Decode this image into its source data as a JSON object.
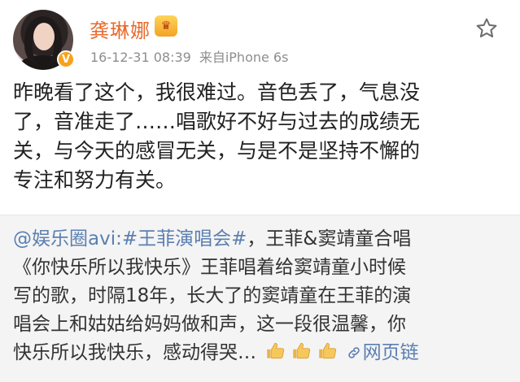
{
  "post": {
    "username": "龚琳娜",
    "vip_badge": "♛",
    "verified_badge": "V",
    "timestamp": "16-12-31 08:39",
    "source": "来自iPhone 6s",
    "content_lines": [
      "昨晚看了这个，我很难过。音色丢了，气息没",
      "了，音准走了……唱歌好不好与过去的成绩无",
      "关，与今天的感冒无关，与是不是坚持不懈的",
      "专注和努力有关。"
    ]
  },
  "repost": {
    "mention": "@娱乐圈avi:",
    "topic": "#王菲演唱会#",
    "line1_rest": "，王菲&窦靖童合唱",
    "line2": "《你快乐所以我快乐》王菲唱着给窦靖童小时候",
    "line3": "写的歌，时隔18年，长大了的窦靖童在王菲的演",
    "line4": "唱会上和姑姑给妈妈做和声，这一段很温馨，你",
    "line5_text": "快乐所以我快乐，感动得哭…",
    "web_link_label": "网页链"
  },
  "icons": {
    "star": "star-icon",
    "thumbs": "thumbs-up-icon",
    "link": "link-icon"
  },
  "colors": {
    "username": "#e86a2d",
    "link": "#5b7fb1",
    "meta": "#8e8e8e",
    "repost_bg": "#f4f4f4"
  }
}
